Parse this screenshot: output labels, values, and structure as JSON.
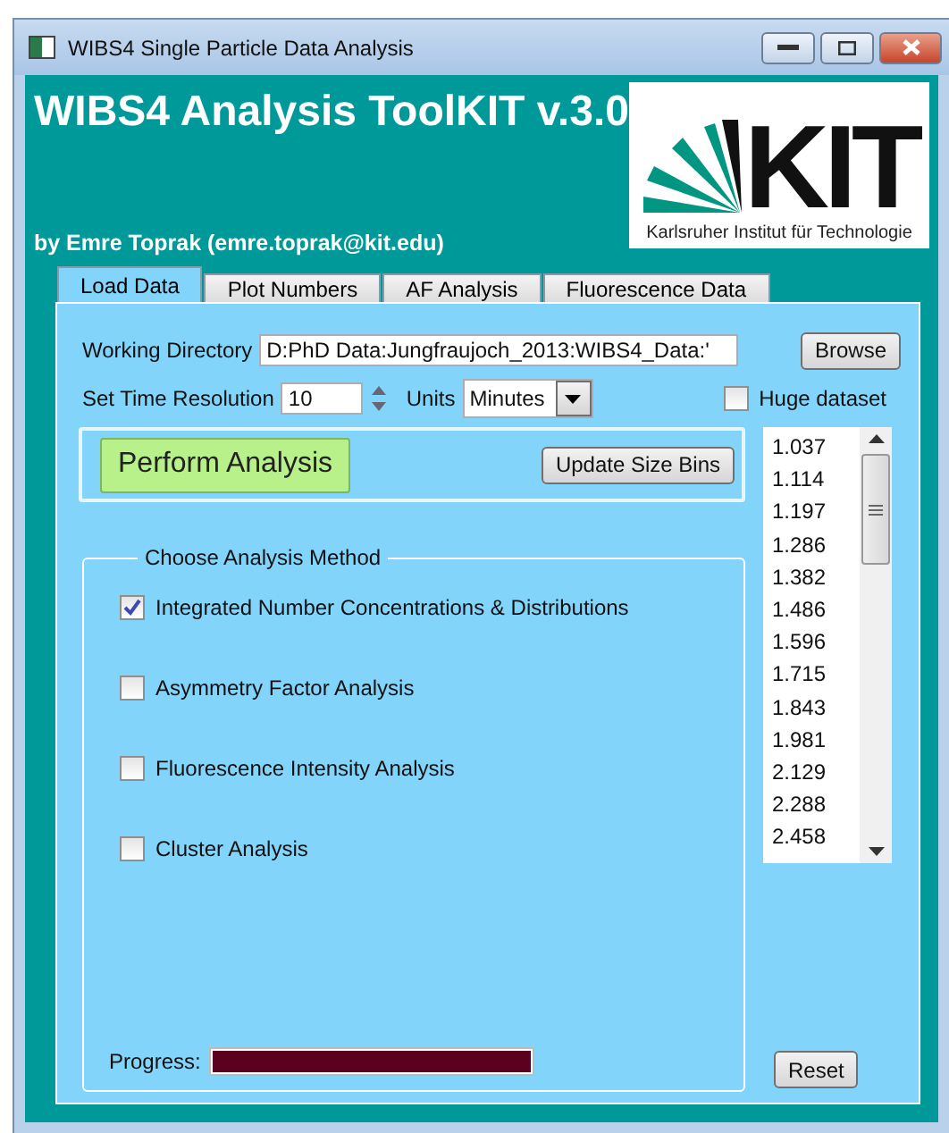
{
  "window": {
    "title": "WIBS4 Single Particle Data Analysis"
  },
  "header": {
    "title": "WIBS4 Analysis ToolKIT v.3.0",
    "author": "by Emre Toprak (emre.toprak@kit.edu)",
    "logo_letters": "KIT",
    "logo_caption": "Karlsruher Institut für Technologie"
  },
  "tabs": [
    {
      "label": "Load Data",
      "selected": true
    },
    {
      "label": "Plot Numbers",
      "selected": false
    },
    {
      "label": "AF Analysis",
      "selected": false
    },
    {
      "label": "Fluorescence Data",
      "selected": false
    }
  ],
  "working_directory": {
    "label": "Working Directory",
    "value": "D:PhD Data:Jungfraujoch_2013:WIBS4_Data:'",
    "button": "Browse"
  },
  "time_resolution": {
    "label": "Set Time Resolution",
    "value": "10",
    "units_label": "Units",
    "units_value": "Minutes"
  },
  "huge_dataset": {
    "label": "Huge dataset",
    "checked": false
  },
  "perform_button": "Perform Analysis",
  "update_button": "Update Size Bins",
  "methods": {
    "title": "Choose Analysis Method",
    "items": [
      {
        "label": "Integrated Number Concentrations & Distributions",
        "checked": true
      },
      {
        "label": "Asymmetry Factor Analysis",
        "checked": false
      },
      {
        "label": "Fluorescence Intensity Analysis",
        "checked": false
      },
      {
        "label": "Cluster Analysis",
        "checked": false
      }
    ]
  },
  "progress": {
    "label": "Progress:",
    "level": 1
  },
  "size_bins": [
    "1.037",
    "1.114",
    "1.197",
    "1.286",
    "1.382",
    "1.486",
    "1.596",
    "1.715",
    "1.843",
    "1.981",
    "2.129",
    "2.288",
    "2.458"
  ],
  "reset_button": "Reset"
}
